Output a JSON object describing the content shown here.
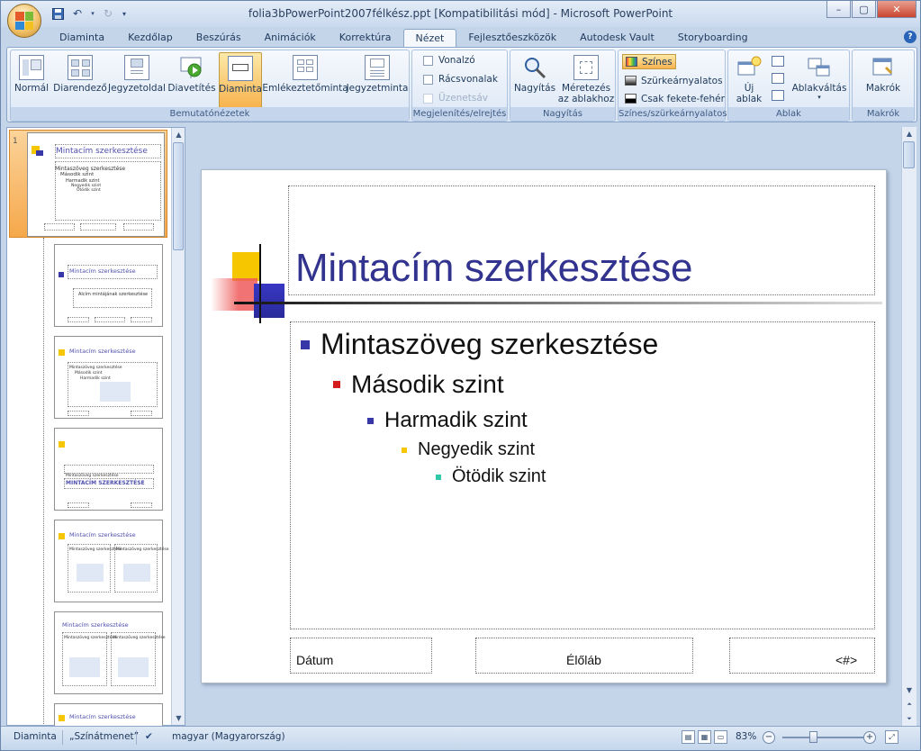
{
  "window": {
    "title": "folia3bPowerPoint2007félkész.ppt [Kompatibilitási mód] - Microsoft PowerPoint",
    "controls": {
      "minimize": "–",
      "maximize": "▢",
      "close": "✕"
    }
  },
  "tabs": [
    "Diaminta",
    "Kezdőlap",
    "Beszúrás",
    "Animációk",
    "Korrektúra",
    "Nézet",
    "Fejlesztőeszközök",
    "Autodesk Vault",
    "Storyboarding"
  ],
  "active_tab": "Nézet",
  "help": "?",
  "ribbon": {
    "views": {
      "label": "Bemutatónézetek",
      "buttons": [
        "Normál",
        "Diarendező",
        "Jegyzetoldal",
        "Diavetítés",
        "Diaminta",
        "Emlékeztetőminta",
        "Jegyzetminta"
      ],
      "active": "Diaminta"
    },
    "show": {
      "label": "Megjelenítés/elrejtés",
      "items": [
        "Vonalzó",
        "Rácsvonalak",
        "Üzenetsáv"
      ]
    },
    "zoom": {
      "label": "Nagyítás",
      "zoom_btn": "Nagyítás",
      "fit_line1": "Méretezés",
      "fit_line2": "az ablakhoz"
    },
    "color": {
      "label": "Színes/szürkeárnyalatos",
      "items": [
        "Színes",
        "Szürkeárnyalatos",
        "Csak fekete-fehér"
      ]
    },
    "window": {
      "label": "Ablak",
      "new_line1": "Új",
      "new_line2": "ablak",
      "switch": "Ablakváltás"
    },
    "macros": {
      "label": "Makrók",
      "btn": "Makrók"
    }
  },
  "thumbnails": {
    "first_num": "1",
    "master_title": "Mintacím szerkesztése",
    "master_text": [
      "Mintaszöveg szerkesztése",
      "Második szint",
      "Harmadik szint",
      "Negyedik szint",
      "Ötödik szint"
    ],
    "small_title": "Mintacím szerkesztése",
    "small_sub": "Alcím mintájának szerkesztése",
    "caps_title": "MINTACÍM SZERKESZTÉSE",
    "caps_sub": "Mintaszöveg szerkesztése"
  },
  "slide": {
    "title": "Mintacím szerkesztése",
    "levels": [
      "Mintaszöveg szerkesztése",
      "Második szint",
      "Harmadik szint",
      "Negyedik szint",
      "Ötödik szint"
    ],
    "footer_date": "Dátum",
    "footer_center": "Élőláb",
    "footer_num": "<#>"
  },
  "status": {
    "view": "Diaminta",
    "theme": "„Színátmenet”",
    "language": "magyar (Magyarország)",
    "zoom": "83%"
  }
}
